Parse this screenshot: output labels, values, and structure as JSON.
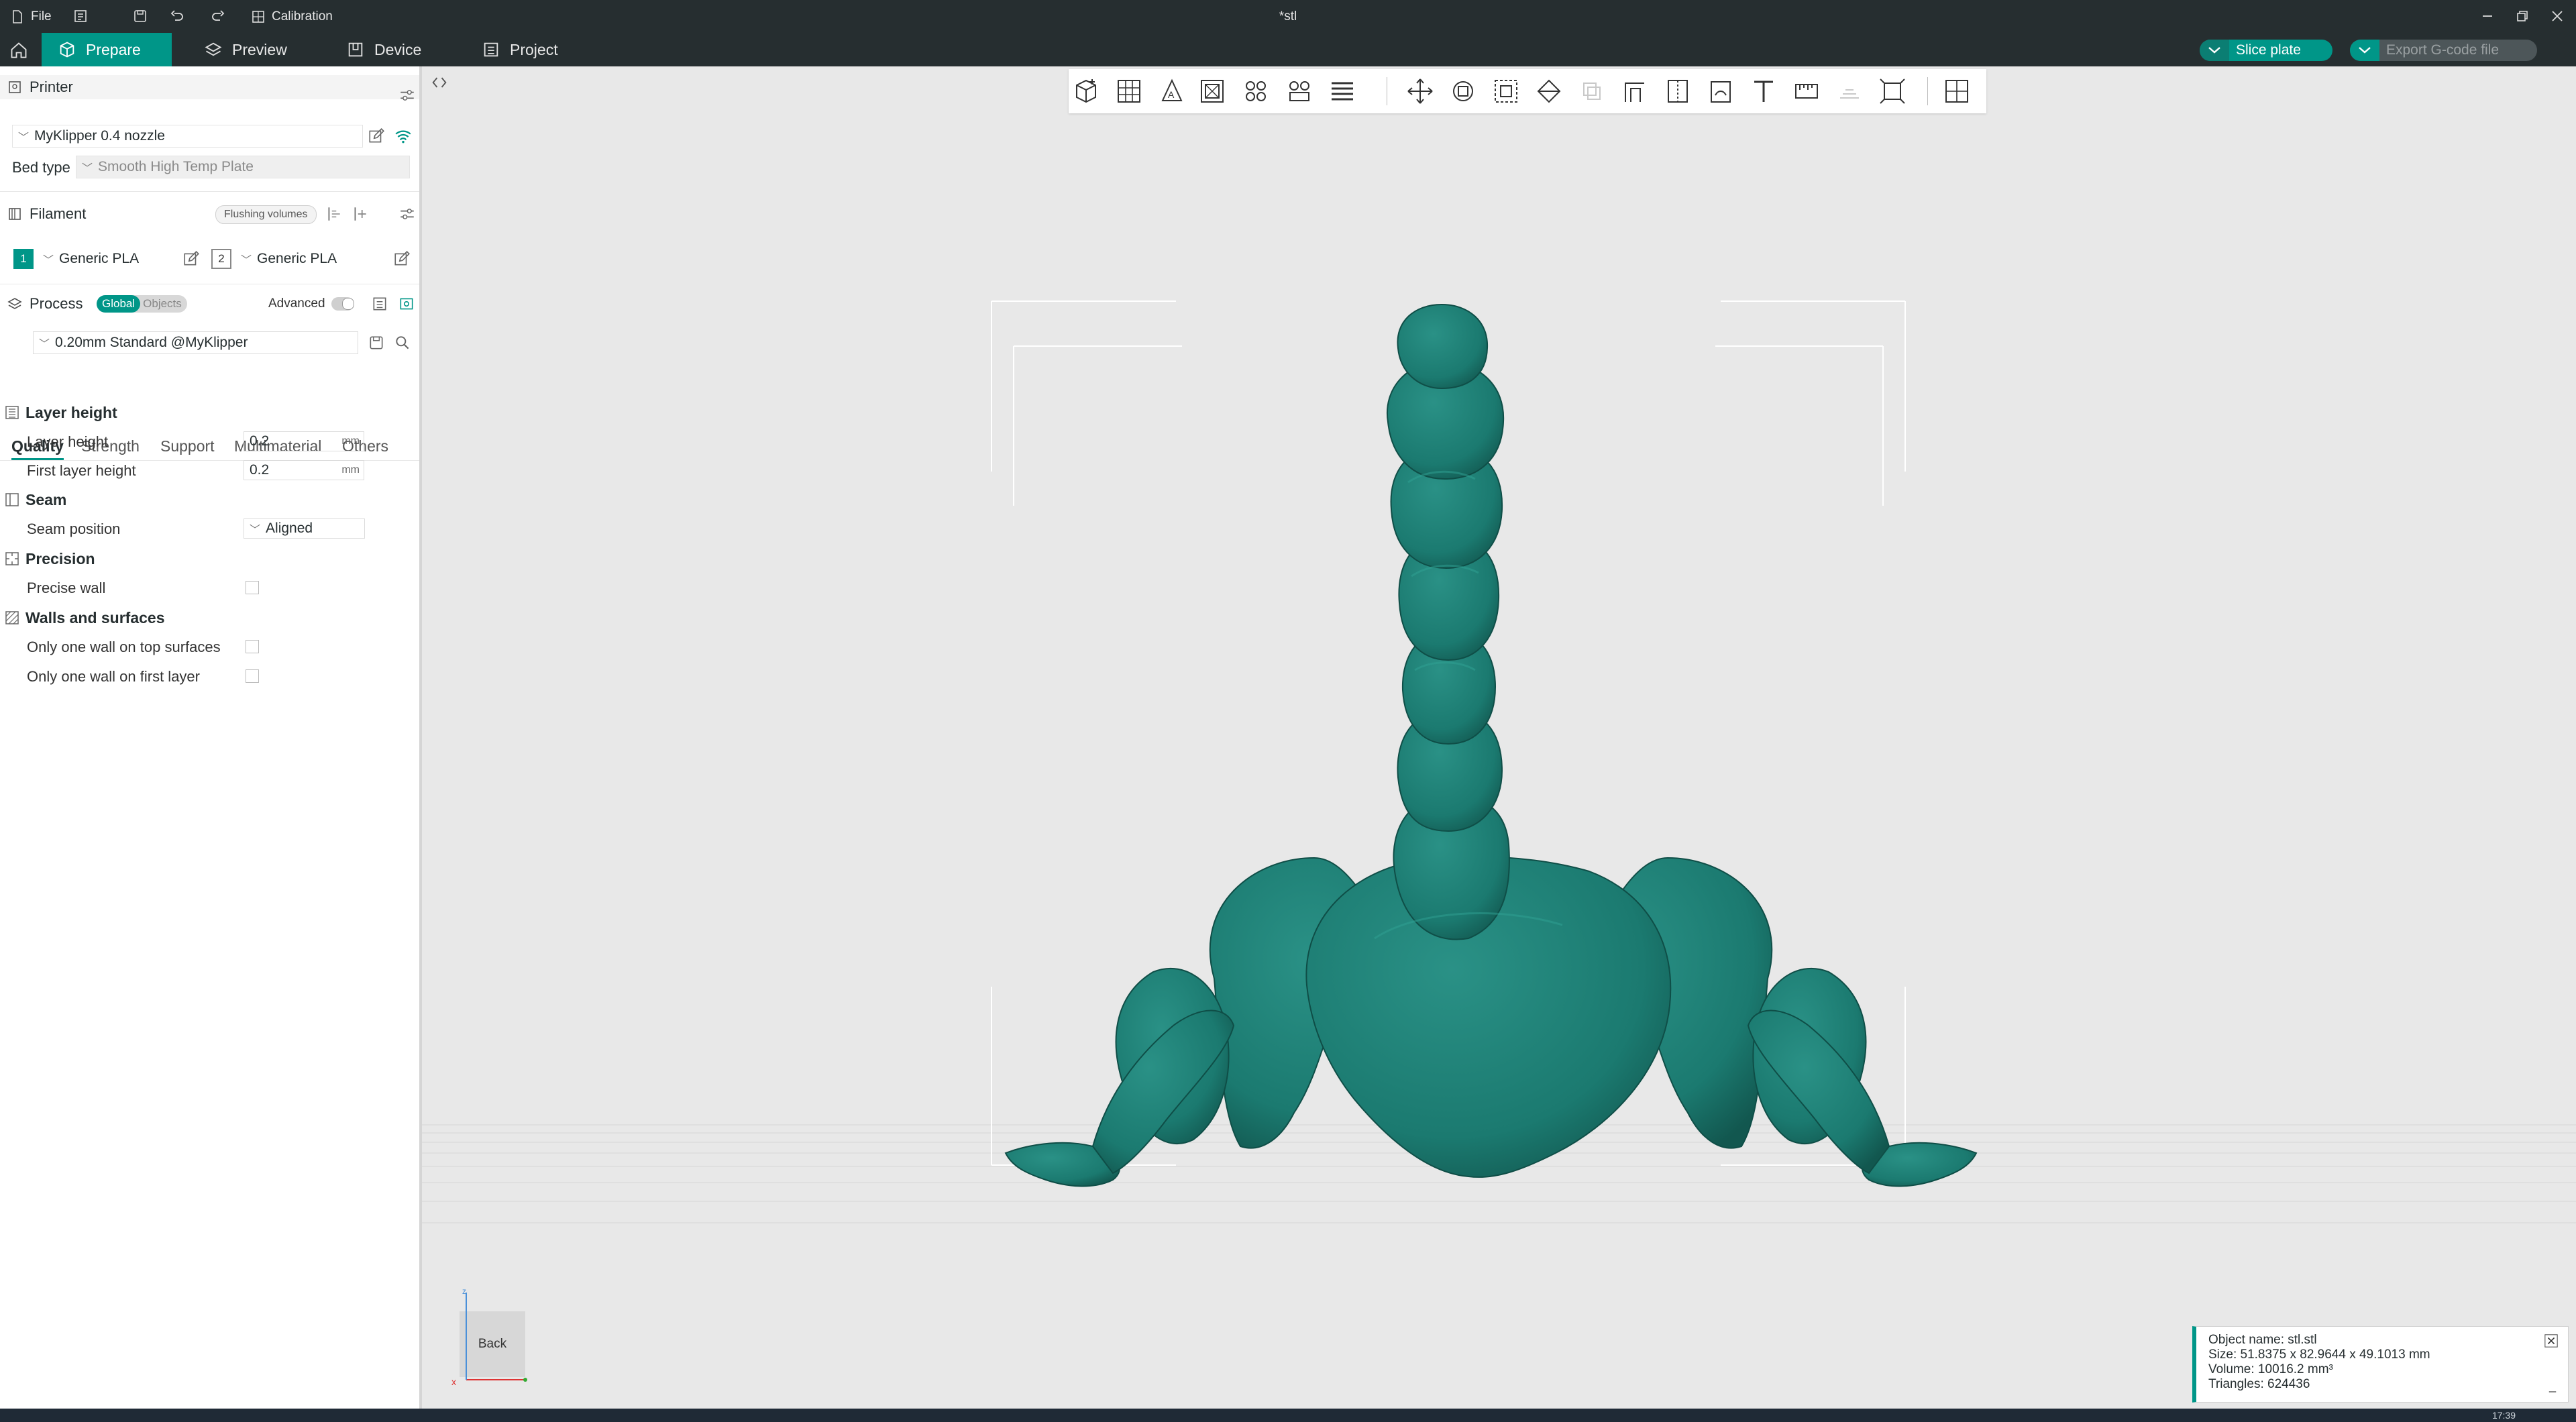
{
  "titlebar": {
    "file_label": "File",
    "calibration_label": "Calibration",
    "doc_title": "*stl"
  },
  "menubar": {
    "tabs": [
      {
        "label": "Prepare",
        "icon": "cube-icon",
        "active": true
      },
      {
        "label": "Preview",
        "icon": "layers-icon",
        "active": false
      },
      {
        "label": "Device",
        "icon": "device-icon",
        "active": false
      },
      {
        "label": "Project",
        "icon": "project-icon",
        "active": false
      }
    ],
    "slice_label": "Slice plate",
    "export_label": "Export G-code file",
    "accent": "#009688",
    "bar_color": "#262e30"
  },
  "sidebar": {
    "printer": {
      "title": "Printer",
      "preset": "MyKlipper 0.4 nozzle",
      "bed_type_label": "Bed type",
      "bed_type_value": "Smooth High Temp Plate"
    },
    "filament": {
      "title": "Filament",
      "flushing_label": "Flushing volumes",
      "slots": [
        {
          "index": "1",
          "name": "Generic PLA"
        },
        {
          "index": "2",
          "name": "Generic PLA"
        }
      ]
    },
    "process": {
      "title": "Process",
      "toggle_global": "Global",
      "toggle_objects": "Objects",
      "advanced_label": "Advanced",
      "preset": "0.20mm Standard @MyKlipper"
    },
    "tabs": [
      "Quality",
      "Strength",
      "Support",
      "Multimaterial",
      "Others"
    ],
    "groups": {
      "layer_height": {
        "title": "Layer height",
        "layer_height_label": "Layer height",
        "layer_height_value": "0.2",
        "first_layer_label": "First layer height",
        "first_layer_value": "0.2",
        "unit": "mm"
      },
      "seam": {
        "title": "Seam",
        "position_label": "Seam position",
        "position_value": "Aligned"
      },
      "precision": {
        "title": "Precision",
        "precise_wall_label": "Precise wall"
      },
      "walls": {
        "title": "Walls and surfaces",
        "top_label": "Only one wall on top surfaces",
        "first_layer_label": "Only one wall on first layer"
      }
    }
  },
  "viewport": {
    "back_label": "Back",
    "model_color": "#1b7a70",
    "info": {
      "name": "Object name: stl.stl",
      "size": "Size: 51.8375 x 82.9644 x 49.1013 mm",
      "volume": "Volume: 10016.2 mm³",
      "triangles": "Triangles: 624436"
    }
  },
  "taskbar": {
    "clock": "17:39"
  }
}
